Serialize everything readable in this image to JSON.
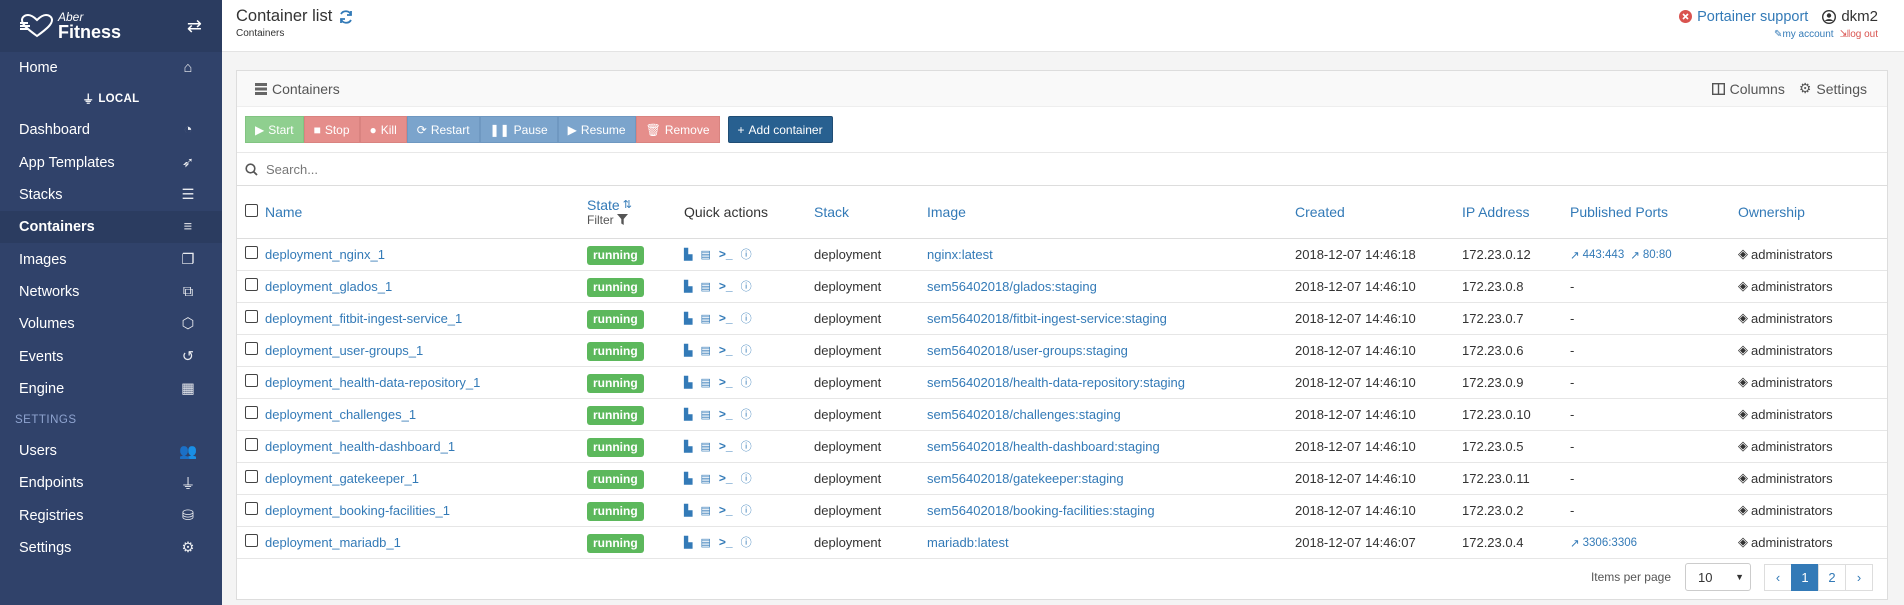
{
  "brand": {
    "line1": "Aber",
    "line2": "Fitness"
  },
  "sidebar": {
    "items_top": [
      {
        "label": "Home",
        "icon": "home-icon"
      }
    ],
    "endpoint": "LOCAL",
    "items": [
      {
        "label": "Dashboard",
        "icon": "tachometer-icon"
      },
      {
        "label": "App Templates",
        "icon": "rocket-icon"
      },
      {
        "label": "Stacks",
        "icon": "list-icon"
      },
      {
        "label": "Containers",
        "icon": "server-icon",
        "active": true
      },
      {
        "label": "Images",
        "icon": "clone-icon"
      },
      {
        "label": "Networks",
        "icon": "sitemap-icon"
      },
      {
        "label": "Volumes",
        "icon": "cubes-icon"
      },
      {
        "label": "Events",
        "icon": "history-icon"
      },
      {
        "label": "Engine",
        "icon": "th-icon"
      }
    ],
    "settings_section": "SETTINGS",
    "settings_items": [
      {
        "label": "Users",
        "icon": "users-icon"
      },
      {
        "label": "Endpoints",
        "icon": "plug-icon"
      },
      {
        "label": "Registries",
        "icon": "database-icon"
      },
      {
        "label": "Settings",
        "icon": "cogs-icon"
      }
    ]
  },
  "header": {
    "title": "Container list",
    "breadcrumb": "Containers",
    "support": "Portainer support",
    "user": "dkm2",
    "my_account": "my account",
    "log_out": "log out"
  },
  "panel": {
    "title": "Containers",
    "columns_label": "Columns",
    "settings_label": "Settings",
    "actions": {
      "start": "Start",
      "stop": "Stop",
      "kill": "Kill",
      "restart": "Restart",
      "pause": "Pause",
      "resume": "Resume",
      "remove": "Remove",
      "add": "Add container"
    },
    "search_placeholder": "Search...",
    "headers": {
      "name": "Name",
      "state": "State",
      "filter": "Filter",
      "quick": "Quick actions",
      "stack": "Stack",
      "image": "Image",
      "created": "Created",
      "ip": "IP Address",
      "ports": "Published Ports",
      "ownership": "Ownership"
    }
  },
  "rows": [
    {
      "name": "deployment_nginx_1",
      "state": "running",
      "stack": "deployment",
      "image": "nginx:latest",
      "created": "2018-12-07 14:46:18",
      "ip": "172.23.0.12",
      "ports": [
        "443:443",
        "80:80"
      ],
      "ownership": "administrators"
    },
    {
      "name": "deployment_glados_1",
      "state": "running",
      "stack": "deployment",
      "image": "sem56402018/glados:staging",
      "created": "2018-12-07 14:46:10",
      "ip": "172.23.0.8",
      "ports": [],
      "ownership": "administrators"
    },
    {
      "name": "deployment_fitbit-ingest-service_1",
      "state": "running",
      "stack": "deployment",
      "image": "sem56402018/fitbit-ingest-service:staging",
      "created": "2018-12-07 14:46:10",
      "ip": "172.23.0.7",
      "ports": [],
      "ownership": "administrators"
    },
    {
      "name": "deployment_user-groups_1",
      "state": "running",
      "stack": "deployment",
      "image": "sem56402018/user-groups:staging",
      "created": "2018-12-07 14:46:10",
      "ip": "172.23.0.6",
      "ports": [],
      "ownership": "administrators"
    },
    {
      "name": "deployment_health-data-repository_1",
      "state": "running",
      "stack": "deployment",
      "image": "sem56402018/health-data-repository:staging",
      "created": "2018-12-07 14:46:10",
      "ip": "172.23.0.9",
      "ports": [],
      "ownership": "administrators"
    },
    {
      "name": "deployment_challenges_1",
      "state": "running",
      "stack": "deployment",
      "image": "sem56402018/challenges:staging",
      "created": "2018-12-07 14:46:10",
      "ip": "172.23.0.10",
      "ports": [],
      "ownership": "administrators"
    },
    {
      "name": "deployment_health-dashboard_1",
      "state": "running",
      "stack": "deployment",
      "image": "sem56402018/health-dashboard:staging",
      "created": "2018-12-07 14:46:10",
      "ip": "172.23.0.5",
      "ports": [],
      "ownership": "administrators"
    },
    {
      "name": "deployment_gatekeeper_1",
      "state": "running",
      "stack": "deployment",
      "image": "sem56402018/gatekeeper:staging",
      "created": "2018-12-07 14:46:10",
      "ip": "172.23.0.11",
      "ports": [],
      "ownership": "administrators"
    },
    {
      "name": "deployment_booking-facilities_1",
      "state": "running",
      "stack": "deployment",
      "image": "sem56402018/booking-facilities:staging",
      "created": "2018-12-07 14:46:10",
      "ip": "172.23.0.2",
      "ports": [],
      "ownership": "administrators"
    },
    {
      "name": "deployment_mariadb_1",
      "state": "running",
      "stack": "deployment",
      "image": "mariadb:latest",
      "created": "2018-12-07 14:46:07",
      "ip": "172.23.0.4",
      "ports": [
        "3306:3306"
      ],
      "ownership": "administrators"
    }
  ],
  "empty_ports": "-",
  "footer": {
    "items_per_page_label": "Items per page",
    "items_per_page": "10",
    "pages": [
      "1",
      "2"
    ],
    "current_page": "1",
    "prev": "‹",
    "next": "›"
  }
}
